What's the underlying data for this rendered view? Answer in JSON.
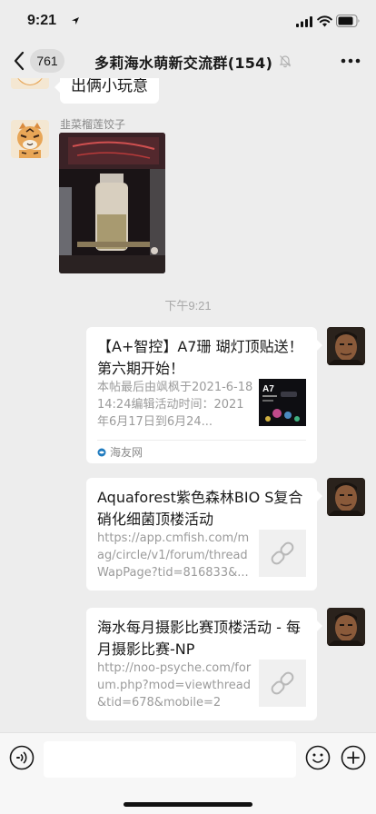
{
  "status_bar": {
    "time": "9:21"
  },
  "header": {
    "unread_count": "761",
    "title": "多莉海水萌新交流群(154)"
  },
  "messages": {
    "first_bubble_text": "出俩小玩意",
    "sender_name": "韭菜榴莲饺子",
    "time_separator": "下午9:21"
  },
  "cards": [
    {
      "title": "【A+智控】A7珊 瑚灯顶贴送！第六期开始！",
      "desc": "本帖最后由飒枫于2021-6-1814:24编辑活动时间：2021年6月17日到6月24...",
      "thumb_label": "A7",
      "source": "海友网"
    },
    {
      "title": "Aquaforest紫色森林BIO S复合硝化细菌顶楼活动",
      "desc": "https://app.cmfish.com/mag/circle/v1/forum/threadWapPage?tid=816833&..."
    },
    {
      "title": "海水每月摄影比赛顶楼活动 - 每月摄影比赛-NP",
      "desc": "http://noo-psyche.com/forum.php?mod=viewthread&tid=678&mobile=2"
    }
  ],
  "icons": {
    "back": "chevron-left-icon",
    "mute": "bell-slash-icon",
    "more": "ellipsis-icon",
    "voice": "voice-icon",
    "emoji": "emoji-icon",
    "plus": "plus-icon",
    "link": "link-icon"
  },
  "colors": {
    "background": "#ededed",
    "bubble": "#ffffff",
    "secondary_text": "#9b9b9b",
    "source_icon": "#1f7bbf"
  }
}
